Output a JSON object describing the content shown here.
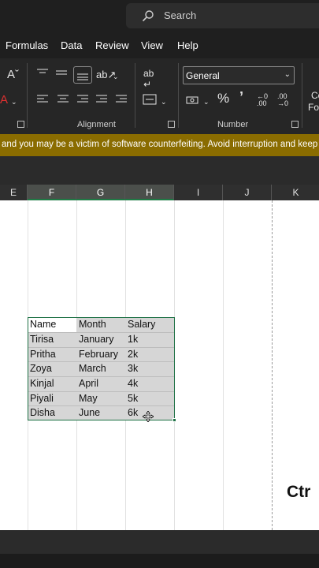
{
  "search": {
    "placeholder": "Search"
  },
  "menu": [
    "Formulas",
    "Data",
    "Review",
    "View",
    "Help"
  ],
  "ribbon": {
    "groups": {
      "alignment_label": "Alignment",
      "number_label": "Number"
    },
    "number_format": "General",
    "font_color_glyph": "A",
    "percent_glyph": "%",
    "comma_glyph": "’",
    "partial_label_top": "Co",
    "partial_label_bottom": "Fo"
  },
  "warning": {
    "text": "and you may be a victim of software counterfeiting. Avoid interruption and keep"
  },
  "columns": [
    "E",
    "F",
    "G",
    "H",
    "I",
    "J",
    "K"
  ],
  "selected_columns": [
    "F",
    "G",
    "H"
  ],
  "table": {
    "header": [
      "Name",
      "Month",
      "Salary"
    ],
    "rows": [
      [
        "Tirisa",
        "January",
        "1k"
      ],
      [
        "Pritha",
        "February",
        "2k"
      ],
      [
        "Zoya",
        "March",
        "3k"
      ],
      [
        "Kinjal",
        "April",
        "4k"
      ],
      [
        "Piyali",
        "May",
        "5k"
      ],
      [
        "Disha",
        "June",
        "6k"
      ]
    ]
  },
  "overlay_text": "Ctr",
  "colors": {
    "accent_green": "#1e7145",
    "warning_bar": "#8a6c00",
    "selection_fill": "#d6d6d6"
  }
}
